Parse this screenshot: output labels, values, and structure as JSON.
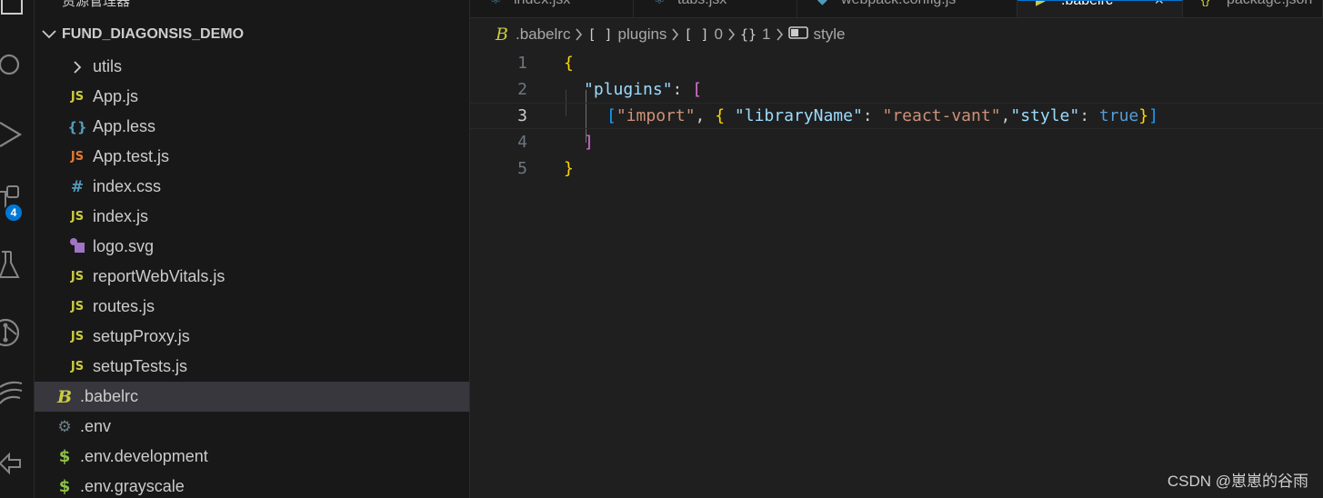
{
  "sidebar": {
    "explorer_title": "资源管理器",
    "project_name": "FUND_DIAGONSIS_DEMO",
    "items": [
      {
        "label": "utils",
        "icon": "chevron-right-icon"
      },
      {
        "label": "App.js",
        "icon": "JS"
      },
      {
        "label": "App.less",
        "icon": "{}"
      },
      {
        "label": "App.test.js",
        "icon": "JS"
      },
      {
        "label": "index.css",
        "icon": "#"
      },
      {
        "label": "index.js",
        "icon": "JS"
      },
      {
        "label": "logo.svg",
        "icon": "svg-icon"
      },
      {
        "label": "reportWebVitals.js",
        "icon": "JS"
      },
      {
        "label": "routes.js",
        "icon": "JS"
      },
      {
        "label": "setupProxy.js",
        "icon": "JS"
      },
      {
        "label": "setupTests.js",
        "icon": "JS"
      },
      {
        "label": ".babelrc",
        "icon": "B"
      },
      {
        "label": ".env",
        "icon": "⚙"
      },
      {
        "label": ".env.development",
        "icon": "$"
      },
      {
        "label": ".env.grayscale",
        "icon": "$"
      }
    ]
  },
  "activity": {
    "badge_count": "4"
  },
  "tabs": [
    {
      "label": "index.jsx"
    },
    {
      "label": "tabs.jsx"
    },
    {
      "label": "webpack.config.js"
    },
    {
      "label": ".babelrc"
    },
    {
      "label": "package.json"
    }
  ],
  "breadcrumb": {
    "file": ".babelrc",
    "seg1_icon": "[ ]",
    "seg1": "plugins",
    "seg2_icon": "[ ]",
    "seg2": "0",
    "seg3_icon": "{}",
    "seg3": "1",
    "seg4": "style"
  },
  "editor": {
    "current_line": 3,
    "lines": [
      {
        "num": "1"
      },
      {
        "num": "2"
      },
      {
        "num": "3"
      },
      {
        "num": "4"
      },
      {
        "num": "5"
      }
    ],
    "tokens": {
      "l1_brace": "{",
      "l2_key": "\"plugins\"",
      "l2_colon": ": ",
      "l2_bracket": "[",
      "l3_bracket_open": "[",
      "l3_str1": "\"import\"",
      "l3_comma1": ", ",
      "l3_brace_open": "{",
      "l3_key1": " \"libraryName\"",
      "l3_colon1": ": ",
      "l3_str2": "\"react-vant\"",
      "l3_comma2": ",",
      "l3_key2": "\"style\"",
      "l3_colon2": ": ",
      "l3_bool": "true",
      "l3_brace_close": "}",
      "l3_bracket_close": "]",
      "l4_bracket": "]",
      "l5_brace": "}"
    }
  },
  "watermark": "CSDN @崽崽的谷雨",
  "colors": {
    "accent": "#0078d4",
    "key": "#9cdcfe",
    "string": "#ce9178",
    "boolean": "#569cd6",
    "brace": "#ffd700",
    "bracket": "#da70d6"
  }
}
